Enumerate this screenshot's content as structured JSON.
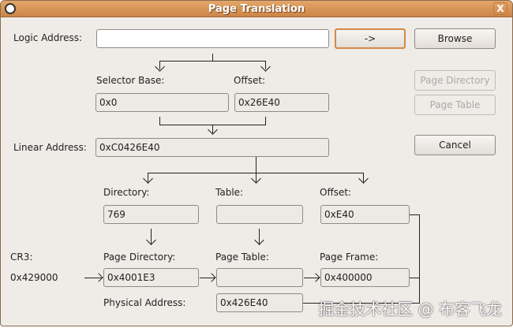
{
  "window": {
    "title": "Page Translation",
    "close_label": "X"
  },
  "logic": {
    "label": "Logic Address:",
    "value": "",
    "go_label": "->",
    "browse_label": "Browse"
  },
  "selector": {
    "base_label": "Selector Base:",
    "base_value": "0x0",
    "offset_label": "Offset:",
    "offset_value": "0x26E40"
  },
  "buttons": {
    "page_directory": "Page Directory",
    "page_table": "Page Table",
    "cancel": "Cancel"
  },
  "linear": {
    "label": "Linear Address:",
    "value": "0xC0426E40"
  },
  "split": {
    "directory_label": "Directory:",
    "directory_value": "769",
    "table_label": "Table:",
    "table_value": "",
    "offset_label": "Offset:",
    "offset_value": "0xE40"
  },
  "walk": {
    "cr3_label": "CR3:",
    "cr3_value": "0x429000",
    "pd_label": "Page Directory:",
    "pd_value": "0x4001E3",
    "pt_label": "Page Table:",
    "pt_value": "",
    "pf_label": "Page Frame:",
    "pf_value": "0x400000"
  },
  "physical": {
    "label": "Physical Address:",
    "value": "0x426E40"
  },
  "watermark": "掘金技术社区 @ 布客飞龙"
}
